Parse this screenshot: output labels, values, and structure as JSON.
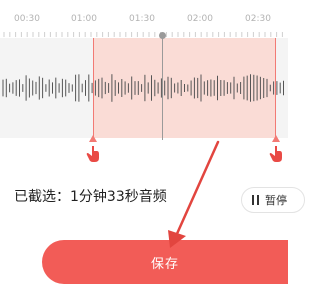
{
  "timeline": {
    "labels": [
      "00:30",
      "01:00",
      "01:30",
      "02:00",
      "02:30"
    ]
  },
  "selection": {
    "summary": "已截选：1分钟33秒音频"
  },
  "controls": {
    "pause_label": "暂停",
    "save_label": "保存"
  },
  "colors": {
    "accent": "#f25c57",
    "selection_fill": "#fad7d0",
    "selection_edge": "#f27a74",
    "waveform": "#555555",
    "background_strip": "#f4f4f4"
  },
  "icons": [
    "pause-icon",
    "left-trim-handle-icon",
    "right-trim-handle-icon",
    "pointer-arrow-icon"
  ]
}
